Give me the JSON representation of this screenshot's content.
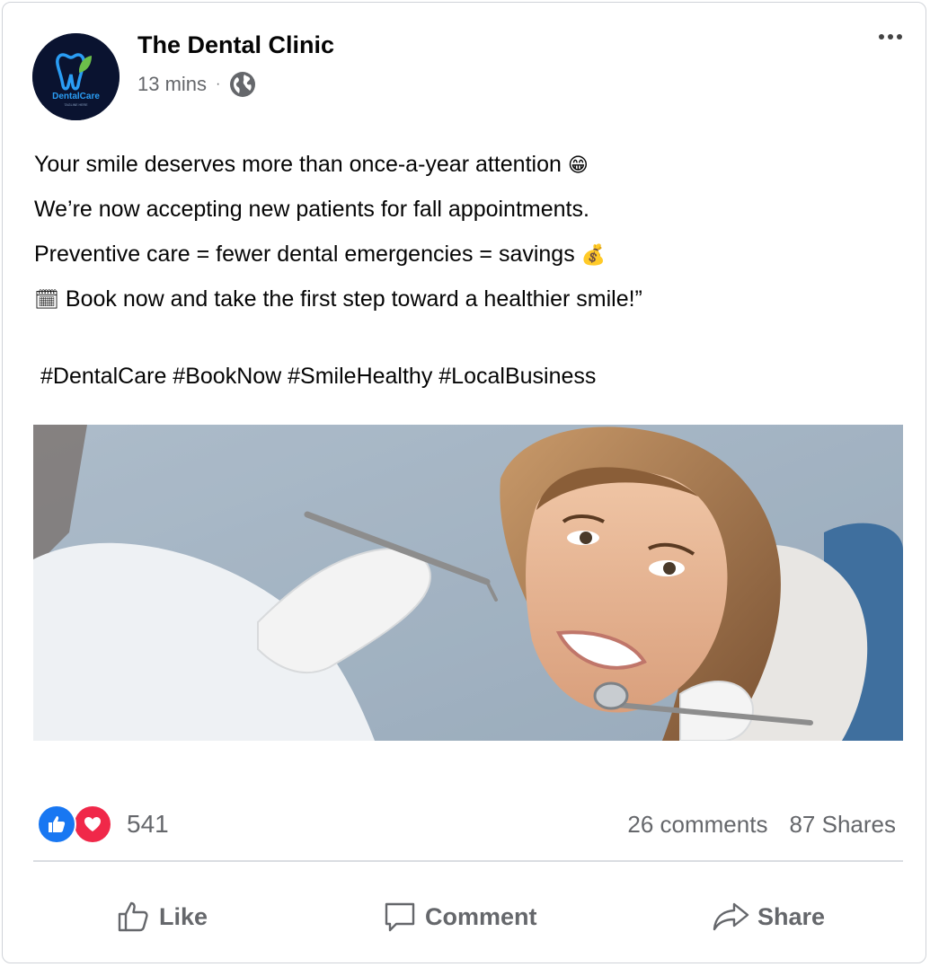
{
  "post": {
    "page_name": "The Dental Clinic",
    "timestamp": "13 mins",
    "separator": "·",
    "avatar_text": "DentalCare",
    "avatar_tagline": "TAGLINE HERE",
    "lines": [
      "Your smile deserves more than once-a-year attention",
      "We’re now accepting new patients for fall appointments.",
      "Preventive care = fewer dental emergencies = savings",
      "Book now and take the first step toward a healthier smile!”"
    ],
    "hashtags": "#DentalCare #BookNow #SmileHealthy #LocalBusiness"
  },
  "engagement": {
    "reaction_count": "541",
    "comments": "26 comments",
    "shares": "87 Shares"
  },
  "actions": {
    "like": "Like",
    "comment": "Comment",
    "share": "Share"
  },
  "colors": {
    "text_primary": "#050505",
    "text_secondary": "#65676b",
    "like_blue": "#1877f2",
    "love_red": "#f02849",
    "divider": "#dadde1",
    "avatar_bg": "#0a1330",
    "logo_tooth": "#2a9df4",
    "logo_leaf": "#6cc04a"
  },
  "icons": {
    "more": "more-dots-icon",
    "audience": "globe-icon",
    "like": "thumbs-up-icon",
    "comment": "speech-bubble-icon",
    "share": "share-arrow-icon",
    "reaction_like": "like-reaction-icon",
    "reaction_love": "love-reaction-icon"
  }
}
